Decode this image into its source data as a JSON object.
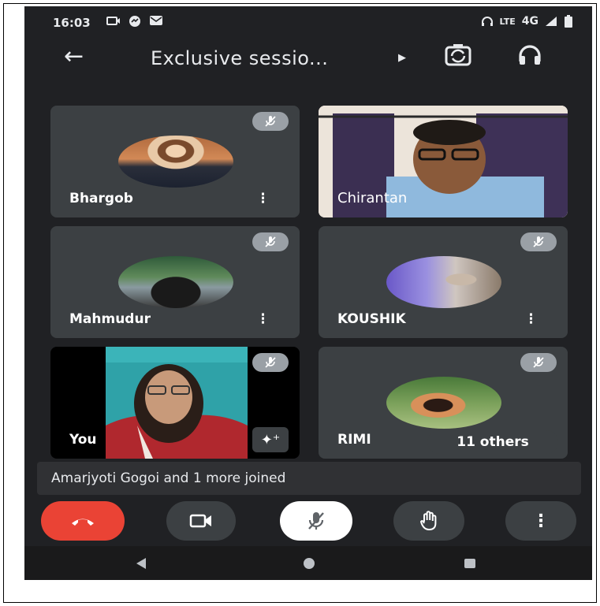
{
  "status_bar": {
    "time": "16:03",
    "network_label": "4G",
    "volte_label": "LTE",
    "left_icons": [
      "screen-cast-icon",
      "messenger-icon",
      "mail-icon"
    ],
    "right_icons": [
      "headphones-icon",
      "volte-icon",
      "signal-icon",
      "battery-icon"
    ]
  },
  "top_bar": {
    "title": "Exclusive sessio...",
    "back_icon": "arrow-left-icon",
    "caret_icon": "caret-right-icon",
    "camera_switch_icon": "switch-camera-icon",
    "audio_icon": "headphones-icon"
  },
  "participants": [
    {
      "name": "Bhargob",
      "muted": true,
      "has_video": false
    },
    {
      "name": "Chirantan",
      "muted": false,
      "has_video": true
    },
    {
      "name": "Mahmudur",
      "muted": true,
      "has_video": false
    },
    {
      "name": "KOUSHIK",
      "muted": true,
      "has_video": false
    },
    {
      "name": "You",
      "muted": true,
      "has_video": true
    },
    {
      "name": "RIMI",
      "muted": true,
      "has_video": false
    }
  ],
  "others_chip": "11 others",
  "notification": "Amarjyoti Gogoi and 1 more joined",
  "controls": [
    {
      "name": "end-call-button",
      "icon": "phone-hangup-icon",
      "color": "#ea4335"
    },
    {
      "name": "camera-toggle-button",
      "icon": "video-camera-icon",
      "color": "#3c4043"
    },
    {
      "name": "mic-toggle-button",
      "icon": "mic-off-icon",
      "color": "#ffffff"
    },
    {
      "name": "raise-hand-button",
      "icon": "hand-icon",
      "color": "#3c4043"
    },
    {
      "name": "more-options-button",
      "icon": "more-vert-icon",
      "color": "#3c4043"
    }
  ],
  "colors": {
    "background": "#202124",
    "tile": "#3c4043",
    "end_call": "#ea4335"
  }
}
